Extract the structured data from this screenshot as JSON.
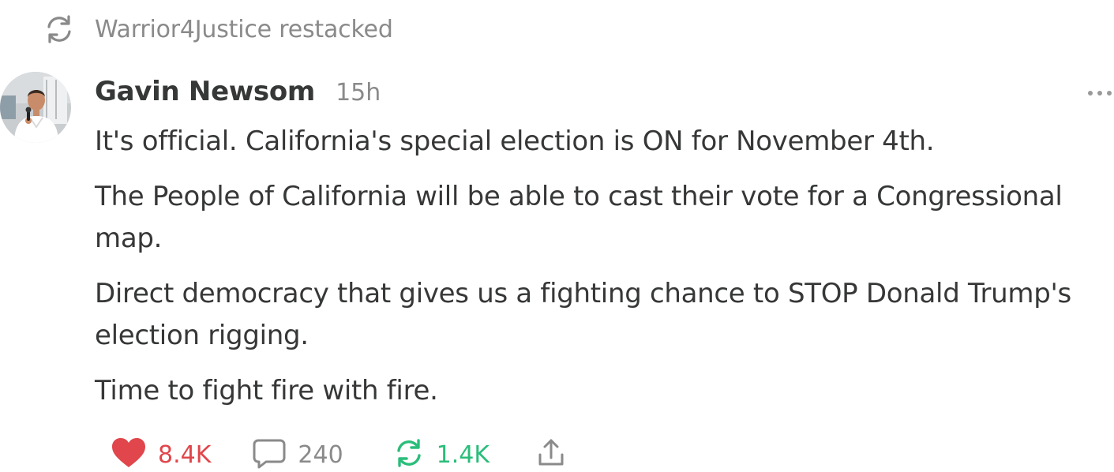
{
  "restack": {
    "icon": "restack-icon",
    "label": "Warrior4Justice restacked"
  },
  "post": {
    "author": "Gavin Newsom",
    "timestamp": "15h",
    "avatar_icon": "avatar-photo",
    "more_icon": "ellipsis-icon",
    "paragraphs": [
      "It's official. California's special election is ON for November 4th.",
      "The People of California will be able to cast their vote for a Congressional map.",
      "Direct democracy that gives us a fighting chance to STOP Donald Trump's election rigging.",
      "Time to fight fire with fire."
    ]
  },
  "actions": {
    "like": {
      "icon": "heart-icon",
      "count": "8.4K",
      "color": "#e0464b"
    },
    "comment": {
      "icon": "comment-icon",
      "count": "240",
      "color": "#8a8a8a"
    },
    "restack": {
      "icon": "restack-icon",
      "count": "1.4K",
      "color": "#2bbd7a"
    },
    "share": {
      "icon": "share-icon"
    }
  }
}
